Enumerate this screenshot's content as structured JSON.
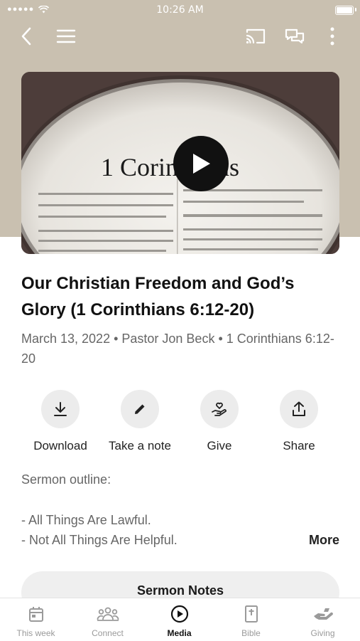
{
  "status_bar": {
    "time": "10:26 AM",
    "signal": "●●●●●"
  },
  "header": {
    "icons": [
      "back-icon",
      "menu-icon",
      "cast-icon",
      "chat-icon",
      "more-icon"
    ]
  },
  "media": {
    "image_text": "1 Corinthians"
  },
  "sermon": {
    "title": "Our Christian Freedom and God’s Glory (1 Corinthians 6:12-20)",
    "meta": "March 13, 2022 • Pastor Jon Beck • 1 Corinthians 6:12-20"
  },
  "actions": [
    {
      "label": "Download",
      "icon": "download-icon"
    },
    {
      "label": "Take a note",
      "icon": "pencil-icon"
    },
    {
      "label": "Give",
      "icon": "give-icon"
    },
    {
      "label": "Share",
      "icon": "share-icon"
    }
  ],
  "outline": {
    "heading": "Sermon outline:",
    "items": [
      "- All Things Are Lawful.",
      "- Not All Things Are Helpful."
    ],
    "more_label": "More"
  },
  "notes_button": {
    "label": "Sermon Notes"
  },
  "tabs": [
    {
      "label": "This week",
      "icon": "calendar-icon",
      "active": false
    },
    {
      "label": "Connect",
      "icon": "people-icon",
      "active": false
    },
    {
      "label": "Media",
      "icon": "play-circle-icon",
      "active": true
    },
    {
      "label": "Bible",
      "icon": "bible-icon",
      "active": false
    },
    {
      "label": "Giving",
      "icon": "giving-hand-icon",
      "active": false
    }
  ],
  "colors": {
    "hero_background": "#c9c0b0",
    "active_tab": "#111111",
    "inactive_tab": "#9a9a9a",
    "button_bg": "#efefef"
  }
}
